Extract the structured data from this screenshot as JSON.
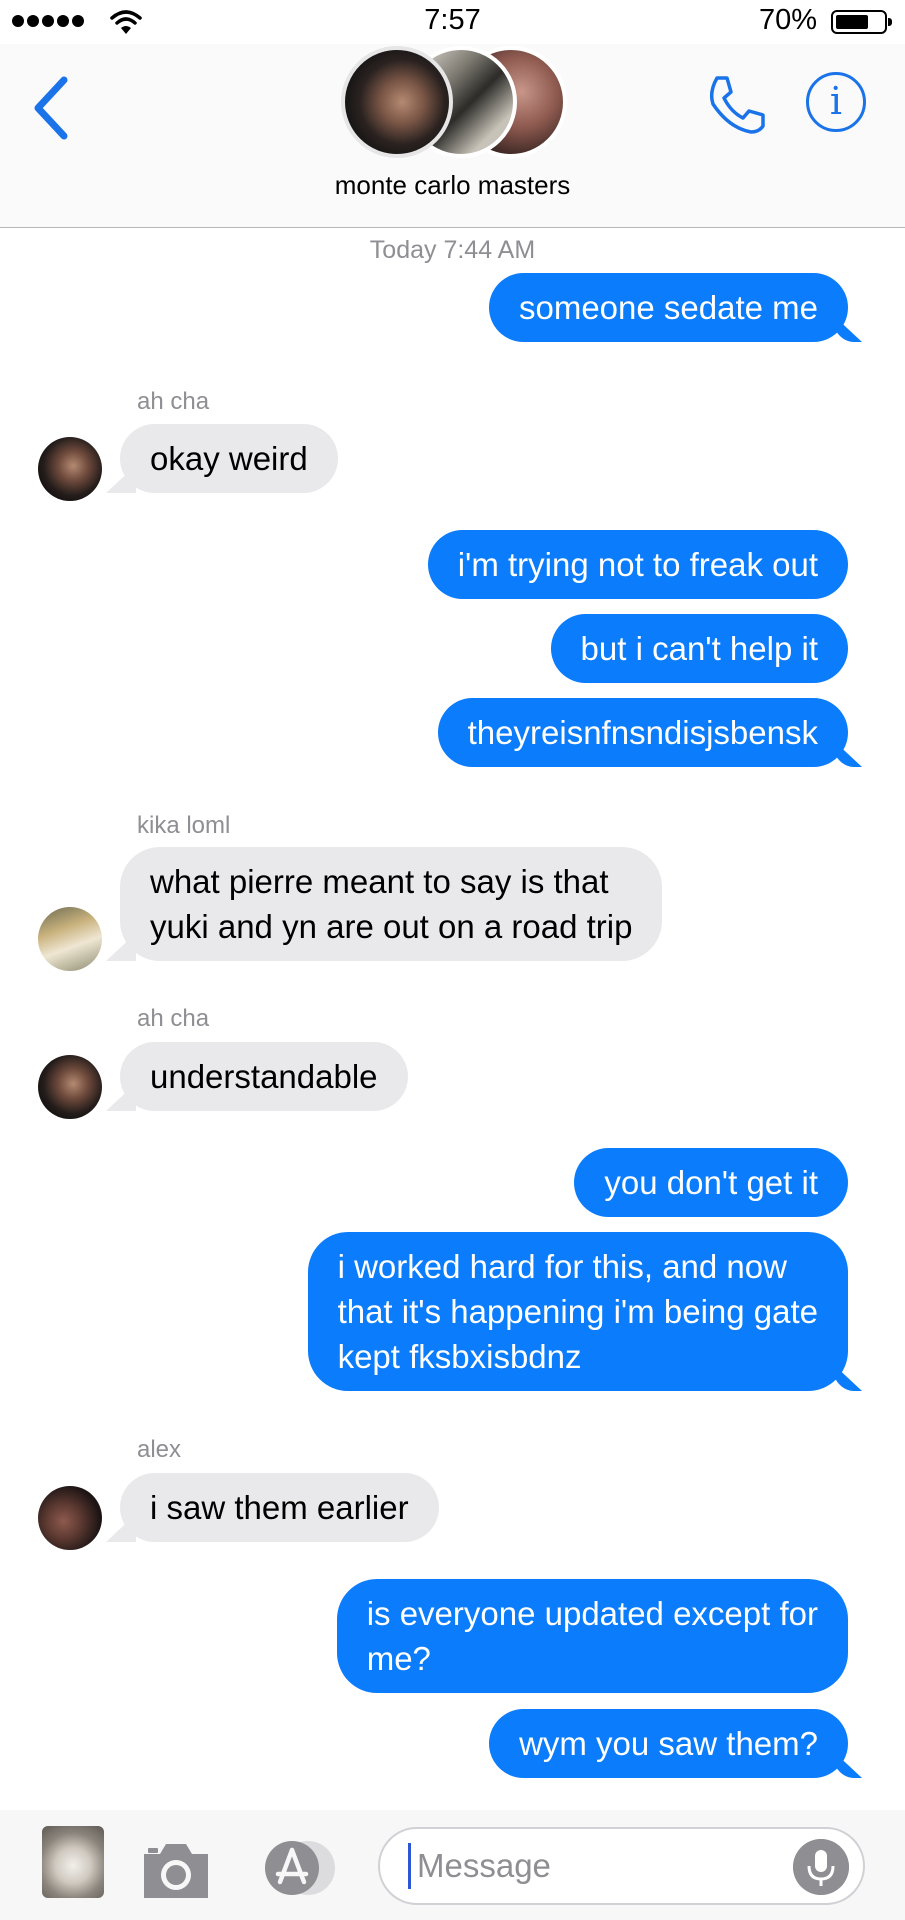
{
  "status_bar": {
    "time": "7:57",
    "battery_percent": "70%",
    "battery_level": 0.7
  },
  "header": {
    "group_name": "monte carlo masters",
    "icons": {
      "back": "chevron-left-icon",
      "call": "phone-icon",
      "info": "info-icon"
    },
    "info_glyph": "i"
  },
  "conversation": {
    "timestamp": "Today 7:44 AM",
    "messages": [
      {
        "id": "m1",
        "direction": "outgoing",
        "lines": [
          "someone sedate me"
        ]
      },
      {
        "id": "m2",
        "direction": "incoming",
        "sender": "ah cha",
        "lines": [
          "okay weird"
        ]
      },
      {
        "id": "m3",
        "direction": "outgoing",
        "lines": [
          "i'm trying not to freak out"
        ]
      },
      {
        "id": "m4",
        "direction": "outgoing",
        "lines": [
          "but i can't help it"
        ]
      },
      {
        "id": "m5",
        "direction": "outgoing",
        "lines": [
          "theyreisnfnsndisjsbensk"
        ]
      },
      {
        "id": "m6",
        "direction": "incoming",
        "sender": "kika loml",
        "lines": [
          "what pierre meant to say is that",
          "yuki and yn are out on a road trip"
        ]
      },
      {
        "id": "m7",
        "direction": "incoming",
        "sender": "ah cha",
        "lines": [
          "understandable"
        ]
      },
      {
        "id": "m8",
        "direction": "outgoing",
        "lines": [
          "you don't get it"
        ]
      },
      {
        "id": "m9",
        "direction": "outgoing",
        "lines": [
          "i worked hard for this, and now",
          "that it's happening i'm being gate",
          "kept fksbxisbdnz"
        ]
      },
      {
        "id": "m10",
        "direction": "incoming",
        "sender": "alex",
        "lines": [
          "i saw them earlier"
        ]
      },
      {
        "id": "m11",
        "direction": "outgoing",
        "lines": [
          "is everyone updated except for",
          "me?"
        ]
      },
      {
        "id": "m12",
        "direction": "outgoing",
        "lines": [
          "wym you saw them?"
        ]
      }
    ]
  },
  "input_bar": {
    "placeholder": "Message",
    "icons": {
      "photo": "photo-thumbnail",
      "camera": "camera-icon",
      "apps": "app-store-icon",
      "mic": "microphone-icon"
    }
  },
  "colors": {
    "outgoing_bubble": "#0b7cfb",
    "incoming_bubble": "#e9e9eb",
    "accent": "#1a73e8"
  }
}
